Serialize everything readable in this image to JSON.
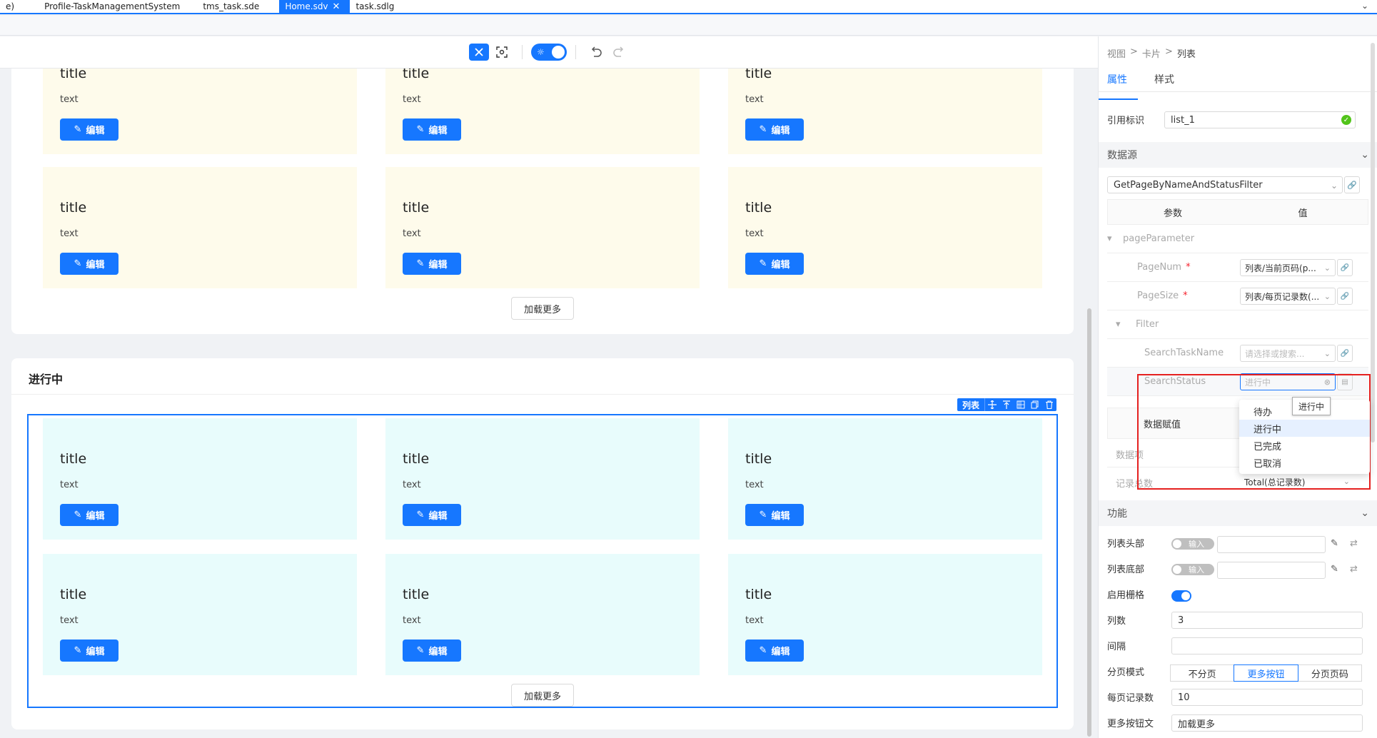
{
  "tabs": [
    {
      "label": "e)"
    },
    {
      "label": "Profile-TaskManagementSystem"
    },
    {
      "label": "tms_task.sde"
    },
    {
      "label": "Home.sdv",
      "active": true
    },
    {
      "label": "task.sdlg"
    }
  ],
  "canvas": {
    "sections": [
      {
        "title": "",
        "cards": [
          {
            "title": "title",
            "text": "text",
            "button": "编辑"
          },
          {
            "title": "title",
            "text": "text",
            "button": "编辑"
          },
          {
            "title": "title",
            "text": "text",
            "button": "编辑"
          },
          {
            "title": "title",
            "text": "text",
            "button": "编辑"
          },
          {
            "title": "title",
            "text": "text",
            "button": "编辑"
          },
          {
            "title": "title",
            "text": "text",
            "button": "编辑"
          }
        ],
        "load_more": "加载更多"
      },
      {
        "title": "进行中",
        "cards": [
          {
            "title": "title",
            "text": "text",
            "button": "编辑"
          },
          {
            "title": "title",
            "text": "text",
            "button": "编辑"
          },
          {
            "title": "title",
            "text": "text",
            "button": "编辑"
          },
          {
            "title": "title",
            "text": "text",
            "button": "编辑"
          },
          {
            "title": "title",
            "text": "text",
            "button": "编辑"
          },
          {
            "title": "title",
            "text": "text",
            "button": "编辑"
          }
        ],
        "load_more": "加载更多"
      }
    ],
    "selection_label": "列表"
  },
  "panel": {
    "breadcrumb": [
      "视图",
      "卡片",
      "列表"
    ],
    "tabs": [
      "属性",
      "样式"
    ],
    "ref_label": "引用标识",
    "ref_value": "list_1",
    "datasource_title": "数据源",
    "datasource_value": "GetPageByNameAndStatusFilter",
    "params_header": [
      "参数",
      "值"
    ],
    "param_group": "pageParameter",
    "page_num": {
      "key": "PageNum",
      "value": "列表/当前页码(p..."
    },
    "page_size": {
      "key": "PageSize",
      "value": "列表/每页记录数(..."
    },
    "filter_group": "Filter",
    "search_task_name": {
      "key": "SearchTaskName",
      "placeholder": "请选择或搜索..."
    },
    "search_status": {
      "key": "SearchStatus",
      "value": "进行中"
    },
    "data_assign": "数据赋值",
    "data_items_label": "数据项",
    "total_label": "记录总数",
    "total_value": "Total(总记录数)",
    "dropdown_options": [
      "待办",
      "进行中",
      "已完成",
      "已取消"
    ],
    "tooltip": "进行中",
    "function_title": "功能",
    "list_header_label": "列表头部",
    "list_footer_label": "列表底部",
    "switch_input_label": "输入",
    "enable_grid_label": "启用栅格",
    "columns_label": "列数",
    "columns_value": "3",
    "gap_label": "间隔",
    "paging_mode_label": "分页模式",
    "paging_modes": [
      "不分页",
      "更多按钮",
      "分页页码"
    ],
    "page_size_label": "每页记录数",
    "page_size_value": "10",
    "more_btn_text_label": "更多按钮文",
    "more_btn_text_value": "加载更多"
  },
  "colors": {
    "accent": "#1677ff",
    "card_yellow": "#fefbeb",
    "card_cyan": "#e8fcfc",
    "highlight": "#e5201f"
  }
}
